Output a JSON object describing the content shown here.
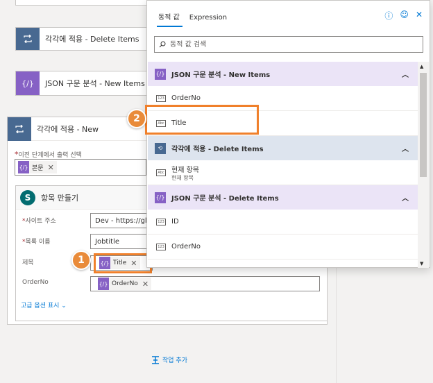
{
  "canvas": {
    "apply_each_delete": "각각에 적용 - Delete Items",
    "json_parse_new": "JSON 구문 분석 - New Items",
    "apply_each_new": "각각에 적용 - New",
    "prev_step_label": "이전 단계에서 출력 선택",
    "body_token": "본문",
    "create_item_title": "항목 만들기",
    "site_address_label": "사이트 주소",
    "site_address_value": "Dev - https://glo",
    "list_name_label": "목록 이름",
    "list_name_value": "Jobtitle",
    "title_label": "제목",
    "title_token": "Title",
    "orderno_label": "OrderNo",
    "orderno_token": "OrderNo",
    "advanced_options": "고급 옵션 표시",
    "add_action": "작업 추가"
  },
  "panel": {
    "tab_dynamic": "동적 값",
    "tab_expression": "Expression",
    "search_placeholder": "동적 값 검색",
    "groups": [
      {
        "title": "JSON 구문 분석 - New Items",
        "items": [
          "OrderNo",
          "Title"
        ]
      },
      {
        "title": "각각에 적용 - Delete Items",
        "items": [
          {
            "label": "현재 항목",
            "sub": "현재 항목"
          }
        ]
      },
      {
        "title": "JSON 구문 분석 - Delete Items",
        "items": [
          "ID",
          "OrderNo"
        ]
      }
    ]
  },
  "callouts": {
    "one": "1",
    "two": "2"
  },
  "colors": {
    "accent": "#0078d4",
    "json_purple": "#8661c5",
    "loop_blue": "#486991",
    "highlight": "#f0802b"
  }
}
